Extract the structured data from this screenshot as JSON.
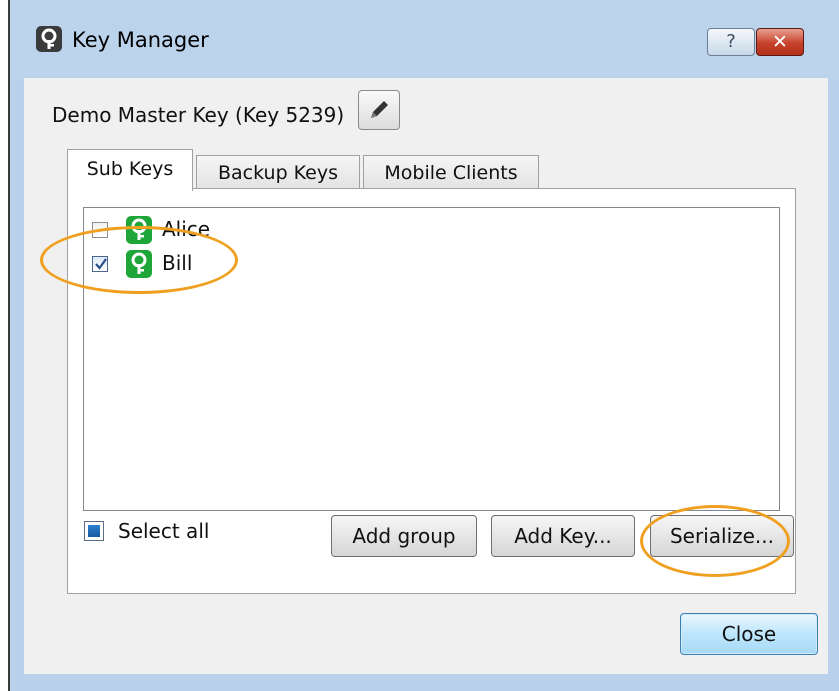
{
  "window": {
    "title": "Key Manager",
    "help_label": "?",
    "close_label": "✕"
  },
  "master_key": {
    "label": "Demo Master Key (Key 5239)",
    "edit_icon": "pencil-icon"
  },
  "tabs": [
    {
      "label": "Sub Keys",
      "active": true
    },
    {
      "label": "Backup Keys",
      "active": false
    },
    {
      "label": "Mobile Clients",
      "active": false
    }
  ],
  "sub_keys": [
    {
      "name": "Alice",
      "checked": false,
      "icon": "key-icon"
    },
    {
      "name": "Bill",
      "checked": true,
      "icon": "key-icon"
    }
  ],
  "select_all": {
    "label": "Select all"
  },
  "buttons": {
    "add_group": "Add group",
    "add_key": "Add Key...",
    "serialize": "Serialize...",
    "close": "Close"
  },
  "colors": {
    "highlight": "#f0a020",
    "key_icon": "#1fa638",
    "title_bar": "#b9d1ea"
  }
}
